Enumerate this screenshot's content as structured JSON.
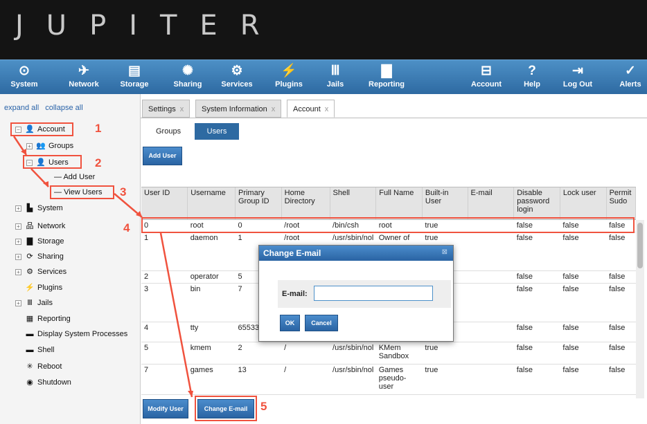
{
  "header": {
    "brand": "JUPITER"
  },
  "toolbar": {
    "items": [
      {
        "label": "System",
        "icon": "system-icon"
      },
      {
        "label": "Network",
        "icon": "network-icon"
      },
      {
        "label": "Storage",
        "icon": "storage-icon"
      },
      {
        "label": "Sharing",
        "icon": "sharing-icon"
      },
      {
        "label": "Services",
        "icon": "services-icon"
      },
      {
        "label": "Plugins",
        "icon": "plugins-icon"
      },
      {
        "label": "Jails",
        "icon": "jails-icon"
      },
      {
        "label": "Reporting",
        "icon": "reporting-icon"
      },
      {
        "label": "Account",
        "icon": "account-icon"
      },
      {
        "label": "Help",
        "icon": "help-icon"
      },
      {
        "label": "Log Out",
        "icon": "logout-icon"
      },
      {
        "label": "Alerts",
        "icon": "alerts-icon"
      }
    ]
  },
  "sidebar": {
    "expand_all": "expand all",
    "collapse_all": "collapse all",
    "items": [
      {
        "label": "Account"
      },
      {
        "label": "Groups"
      },
      {
        "label": "Users"
      },
      {
        "label": "Add User"
      },
      {
        "label": "View Users"
      },
      {
        "label": "System"
      },
      {
        "label": "Network"
      },
      {
        "label": "Storage"
      },
      {
        "label": "Sharing"
      },
      {
        "label": "Services"
      },
      {
        "label": "Plugins"
      },
      {
        "label": "Jails"
      },
      {
        "label": "Reporting"
      },
      {
        "label": "Display System Processes"
      },
      {
        "label": "Shell"
      },
      {
        "label": "Reboot"
      },
      {
        "label": "Shutdown"
      }
    ]
  },
  "annotations": {
    "n1": "1",
    "n2": "2",
    "n3": "3",
    "n4": "4",
    "n5": "5"
  },
  "tabs": [
    {
      "label": "Settings",
      "close": "x"
    },
    {
      "label": "System Information",
      "close": "x"
    },
    {
      "label": "Account",
      "close": "x"
    }
  ],
  "subtabs": {
    "groups": "Groups",
    "users": "Users"
  },
  "buttons": {
    "add_user": "Add User",
    "modify_user": "Modify User",
    "change_email": "Change E-mail"
  },
  "grid": {
    "columns": [
      "User ID",
      "Username",
      "Primary Group ID",
      "Home Directory",
      "Shell",
      "Full Name",
      "Built-in User",
      "E-mail",
      "Disable password login",
      "Lock user",
      "Permit Sudo"
    ],
    "rows": [
      [
        "0",
        "root",
        "0",
        "/root",
        "/bin/csh",
        "root",
        "true",
        "",
        "false",
        "false",
        "false"
      ],
      [
        "1",
        "daemon",
        "1",
        "/root",
        "/usr/sbin/nol",
        "Owner of",
        "true",
        "",
        "false",
        "false",
        "false"
      ],
      [
        "2",
        "operator",
        "5",
        "",
        "",
        "",
        "",
        "",
        "false",
        "false",
        "false"
      ],
      [
        "3",
        "bin",
        "7",
        "",
        "",
        "",
        "",
        "",
        "false",
        "false",
        "false"
      ],
      [
        "4",
        "tty",
        "65533",
        "",
        "",
        "",
        "",
        "",
        "false",
        "false",
        "false"
      ],
      [
        "5",
        "kmem",
        "2",
        "/",
        "/usr/sbin/nol",
        "KMem Sandbox",
        "true",
        "",
        "false",
        "false",
        "false"
      ],
      [
        "7",
        "games",
        "13",
        "/",
        "/usr/sbin/nol",
        "Games pseudo-user",
        "true",
        "",
        "false",
        "false",
        "false"
      ]
    ]
  },
  "dialog": {
    "title": "Change E-mail",
    "close": "⊠",
    "email_label": "E-mail:",
    "email_value": "",
    "ok": "OK",
    "cancel": "Cancel"
  }
}
